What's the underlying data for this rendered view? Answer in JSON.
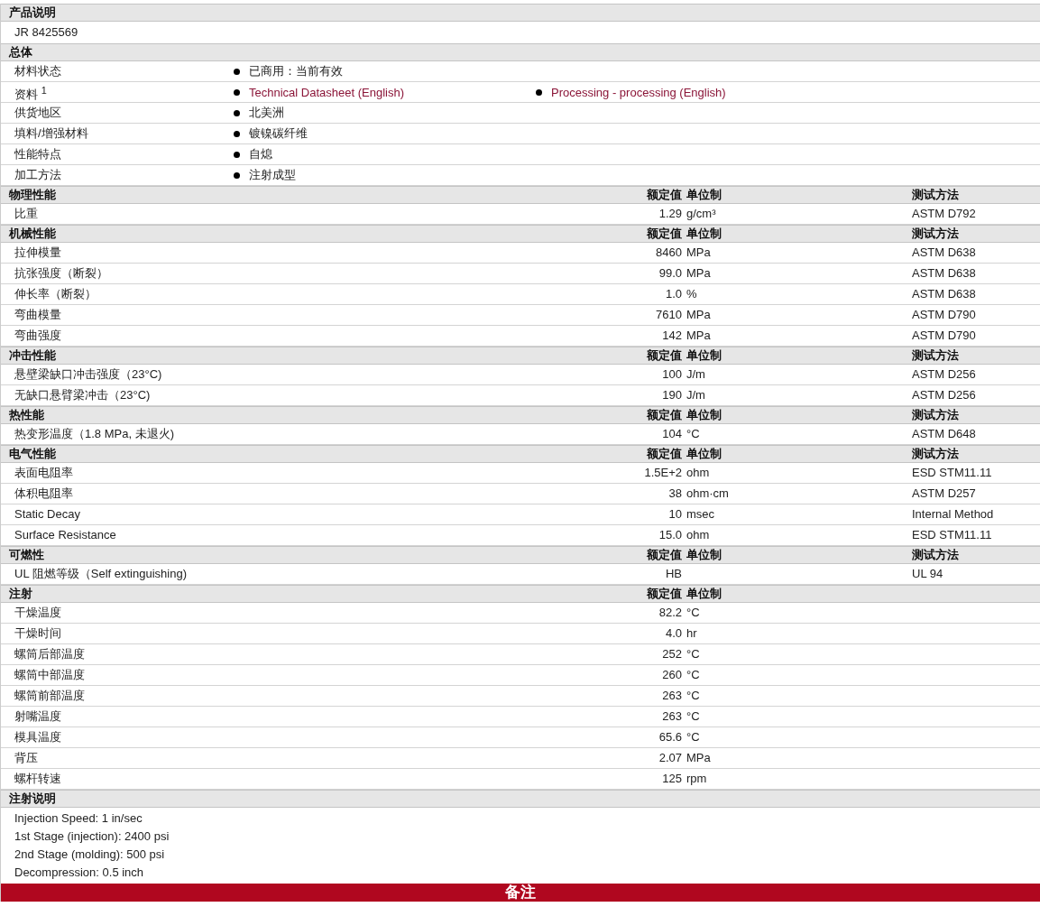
{
  "sections": [
    {
      "kind": "text",
      "title": "产品说明",
      "lines": [
        "JR 8425569"
      ]
    },
    {
      "kind": "general",
      "title": "总体",
      "rows": [
        {
          "label": "材料状态",
          "items": [
            {
              "text": "已商用：当前有效",
              "link": false
            }
          ]
        },
        {
          "label": "资料 $^{1}$",
          "items": [
            {
              "text": "Technical Datasheet (English)",
              "link": true
            },
            {
              "text": "Processing - processing (English)",
              "link": true
            }
          ]
        },
        {
          "label": "供货地区",
          "items": [
            {
              "text": "北美洲",
              "link": false
            }
          ]
        },
        {
          "label": "填料/增强材料",
          "items": [
            {
              "text": "镀镍碳纤维",
              "link": false
            }
          ]
        },
        {
          "label": "性能特点",
          "items": [
            {
              "text": "自熄",
              "link": false
            }
          ]
        },
        {
          "label": "加工方法",
          "items": [
            {
              "text": "注射成型",
              "link": false
            }
          ]
        }
      ]
    },
    {
      "kind": "properties",
      "title": "物理性能",
      "columns": [
        "额定值",
        "单位制",
        "测试方法"
      ],
      "rows": [
        {
          "name": "比重",
          "value": "1.29",
          "unit": "g/cm³",
          "method": "ASTM D792"
        }
      ]
    },
    {
      "kind": "properties",
      "title": "机械性能",
      "columns": [
        "额定值",
        "单位制",
        "测试方法"
      ],
      "rows": [
        {
          "name": "拉伸模量",
          "value": "8460",
          "unit": "MPa",
          "method": "ASTM D638"
        },
        {
          "name": "抗张强度（断裂）",
          "value": "99.0",
          "unit": "MPa",
          "method": "ASTM D638"
        },
        {
          "name": "伸长率（断裂）",
          "value": "1.0",
          "unit": "%",
          "method": "ASTM D638"
        },
        {
          "name": "弯曲模量",
          "value": "7610",
          "unit": "MPa",
          "method": "ASTM D790"
        },
        {
          "name": "弯曲强度",
          "value": "142",
          "unit": "MPa",
          "method": "ASTM D790"
        }
      ]
    },
    {
      "kind": "properties",
      "title": "冲击性能",
      "columns": [
        "额定值",
        "单位制",
        "测试方法"
      ],
      "rows": [
        {
          "name": "悬壁梁缺口冲击强度（23°C)",
          "value": "100",
          "unit": "J/m",
          "method": "ASTM D256"
        },
        {
          "name": "无缺口悬臂梁冲击（23°C)",
          "value": "190",
          "unit": "J/m",
          "method": "ASTM D256"
        }
      ]
    },
    {
      "kind": "properties",
      "title": "热性能",
      "columns": [
        "额定值",
        "单位制",
        "测试方法"
      ],
      "rows": [
        {
          "name": "热变形温度（1.8 MPa, 未退火)",
          "value": "104",
          "unit": "°C",
          "method": "ASTM D648"
        }
      ]
    },
    {
      "kind": "properties",
      "title": "电气性能",
      "columns": [
        "额定值",
        "单位制",
        "测试方法"
      ],
      "rows": [
        {
          "name": "表面电阻率",
          "value": "1.5E+2",
          "unit": "ohm",
          "method": "ESD STM11.11"
        },
        {
          "name": "体积电阻率",
          "value": "38",
          "unit": "ohm·cm",
          "method": "ASTM D257"
        },
        {
          "name": "Static Decay",
          "value": "10",
          "unit": "msec",
          "method": "Internal Method"
        },
        {
          "name": "Surface Resistance",
          "value": "15.0",
          "unit": "ohm",
          "method": "ESD STM11.11"
        }
      ]
    },
    {
      "kind": "properties",
      "title": "可燃性",
      "columns": [
        "额定值",
        "单位制",
        "测试方法"
      ],
      "rows": [
        {
          "name": "UL 阻燃等级（Self extinguishing)",
          "value": "HB",
          "method": "UL 94"
        }
      ]
    },
    {
      "kind": "properties",
      "title": "注射",
      "columns": [
        "额定值",
        "单位制"
      ],
      "rows": [
        {
          "name": "干燥温度",
          "value": "82.2",
          "unit": "°C"
        },
        {
          "name": "干燥时间",
          "value": "4.0",
          "unit": "hr"
        },
        {
          "name": "螺筒后部温度",
          "value": "252",
          "unit": "°C"
        },
        {
          "name": "螺筒中部温度",
          "value": "260",
          "unit": "°C"
        },
        {
          "name": "螺筒前部温度",
          "value": "263",
          "unit": "°C"
        },
        {
          "name": "射嘴温度",
          "value": "263",
          "unit": "°C"
        },
        {
          "name": "模具温度",
          "value": "65.6",
          "unit": "°C"
        },
        {
          "name": "背压",
          "value": "2.07",
          "unit": "MPa"
        },
        {
          "name": "螺杆转速",
          "value": "125",
          "unit": "rpm"
        }
      ]
    },
    {
      "kind": "text",
      "title": "注射说明",
      "lines": [
        "Injection Speed: 1 in/sec",
        "1st Stage (injection): 2400 psi",
        "2nd Stage (molding): 500 psi",
        "Decompression: 0.5 inch"
      ]
    },
    {
      "kind": "banner",
      "title": "备注"
    }
  ]
}
